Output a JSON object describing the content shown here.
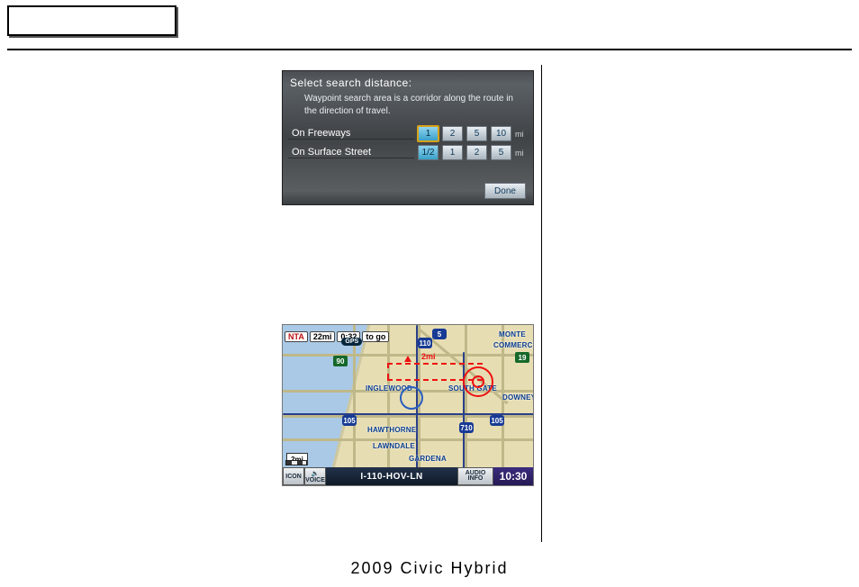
{
  "footer": "2009  Civic  Hybrid",
  "dialog": {
    "title": "Select search distance:",
    "description": "Waypoint search area is a corridor along the route in the direction of travel.",
    "rows": [
      {
        "label": "On Freeways",
        "options": [
          "1",
          "2",
          "5",
          "10"
        ],
        "selected": "1",
        "unit": "mi"
      },
      {
        "label": "On Surface Street",
        "options": [
          "1/2",
          "1",
          "2",
          "5"
        ],
        "selected": "1/2",
        "unit": "mi"
      }
    ],
    "done": "Done"
  },
  "map": {
    "status_prefix": "NTA",
    "distance_to_go": "22mi",
    "time_to_go": "0:32",
    "to_go_label": "to go",
    "gps": "GPS",
    "scale": "2mi",
    "route_width_label": "2mi",
    "street": "I-110-HOV-LN",
    "buttons": {
      "icon": "ICON",
      "voice": "VOICE",
      "audio_line1": "AUDIO",
      "audio_line2": "INFO"
    },
    "clock": "10:30",
    "shields": {
      "r90": "90",
      "r5": "5",
      "r105_left": "105",
      "r105_right": "105",
      "r710": "710",
      "r110": "110",
      "r19": "19"
    },
    "cities": {
      "monte": "MONTE",
      "commerce": "COMMERCE",
      "inglewood": "INGLEWOOD",
      "southgate": "SOUTH GATE",
      "downey": "DOWNEY",
      "hawthorne": "HAWTHORNE",
      "lawndale": "LAWNDALE",
      "gardena": "GARDENA"
    }
  }
}
